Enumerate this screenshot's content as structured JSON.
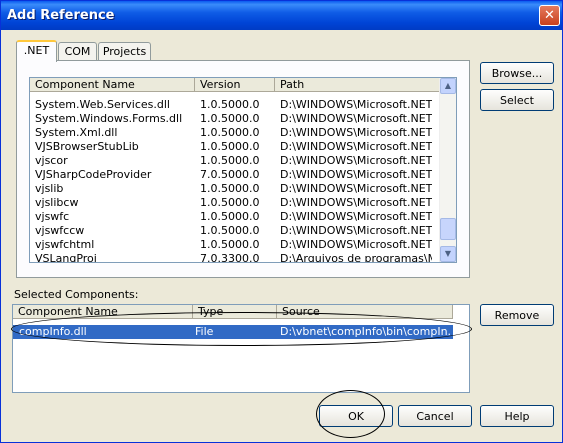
{
  "window": {
    "title": "Add Reference",
    "close_glyph": "✕"
  },
  "tabs": [
    {
      "label": ".NET",
      "active": true
    },
    {
      "label": "COM",
      "active": false
    },
    {
      "label": "Projects",
      "active": false
    }
  ],
  "components_list": {
    "columns": [
      "Component Name",
      "Version",
      "Path"
    ],
    "rows": [
      [
        "System.Web.Services.dll",
        "1.0.5000.0",
        "D:\\WINDOWS\\Microsoft.NET..."
      ],
      [
        "System.Windows.Forms.dll",
        "1.0.5000.0",
        "D:\\WINDOWS\\Microsoft.NET..."
      ],
      [
        "System.Xml.dll",
        "1.0.5000.0",
        "D:\\WINDOWS\\Microsoft.NET..."
      ],
      [
        "VJSBrowserStubLib",
        "1.0.5000.0",
        "D:\\WINDOWS\\Microsoft.NET..."
      ],
      [
        "vjscor",
        "1.0.5000.0",
        "D:\\WINDOWS\\Microsoft.NET..."
      ],
      [
        "VJSharpCodeProvider",
        "7.0.5000.0",
        "D:\\WINDOWS\\Microsoft.NET..."
      ],
      [
        "vjslib",
        "1.0.5000.0",
        "D:\\WINDOWS\\Microsoft.NET..."
      ],
      [
        "vjslibcw",
        "1.0.5000.0",
        "D:\\WINDOWS\\Microsoft.NET..."
      ],
      [
        "vjswfc",
        "1.0.5000.0",
        "D:\\WINDOWS\\Microsoft.NET..."
      ],
      [
        "vjswfccw",
        "1.0.5000.0",
        "D:\\WINDOWS\\Microsoft.NET..."
      ],
      [
        "vjswfchtml",
        "1.0.5000.0",
        "D:\\WINDOWS\\Microsoft.NET..."
      ],
      [
        "VSLangProj",
        "7.0.3300.0",
        "D:\\Arquivos de programas\\Mi..."
      ]
    ]
  },
  "side_buttons": {
    "browse": "Browse...",
    "select": "Select",
    "remove": "Remove"
  },
  "selected_components": {
    "label": "Selected Components:",
    "columns": [
      "Component Name",
      "Type",
      "Source"
    ],
    "rows": [
      [
        "compInfo.dll",
        "File",
        "D:\\vbnet\\compInfo\\bin\\compIn..."
      ]
    ]
  },
  "footer_buttons": {
    "ok": "OK",
    "cancel": "Cancel",
    "help": "Help"
  },
  "colors": {
    "titlebar": "#0054e3",
    "selection": "#316ac5",
    "face": "#ece9d8"
  },
  "icons": {
    "close": "close-icon",
    "scroll_up": "arrow-up-icon",
    "scroll_down": "arrow-down-icon"
  }
}
